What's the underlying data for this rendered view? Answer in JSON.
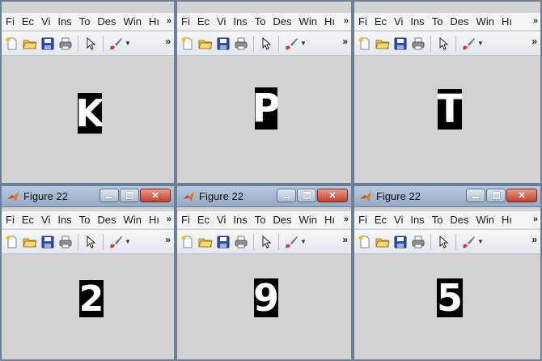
{
  "menu": [
    "Fi",
    "Ec",
    "Vi",
    "Ins",
    "To",
    "Des",
    "Win",
    "Hı"
  ],
  "menu_overflow": "»",
  "toolbar_icons": [
    "new-file-icon",
    "open-folder-icon",
    "save-icon",
    "print-icon",
    "pointer-icon",
    "brush-icon"
  ],
  "toolbar_overflow": "»",
  "windows": [
    {
      "title": "",
      "character": "K",
      "ink": "#ffffff",
      "bg": "#000000"
    },
    {
      "title": "",
      "character": "P",
      "ink": "#ffffff",
      "bg": "#000000"
    },
    {
      "title": "",
      "character": "T",
      "ink": "#ffffff",
      "bg": "#000000"
    },
    {
      "title": "Figure 22",
      "character": "2",
      "ink": "#ffffff",
      "bg": "#000000"
    },
    {
      "title": "Figure 22",
      "character": "9",
      "ink": "#ffffff",
      "bg": "#000000"
    },
    {
      "title": "Figure 22",
      "character": "5",
      "ink": "#ffffff",
      "bg": "#000000"
    }
  ],
  "colors": {
    "canvas": "#d2d2d2",
    "titlebar": "#a5b9d0",
    "close_button": "#c4402b"
  }
}
